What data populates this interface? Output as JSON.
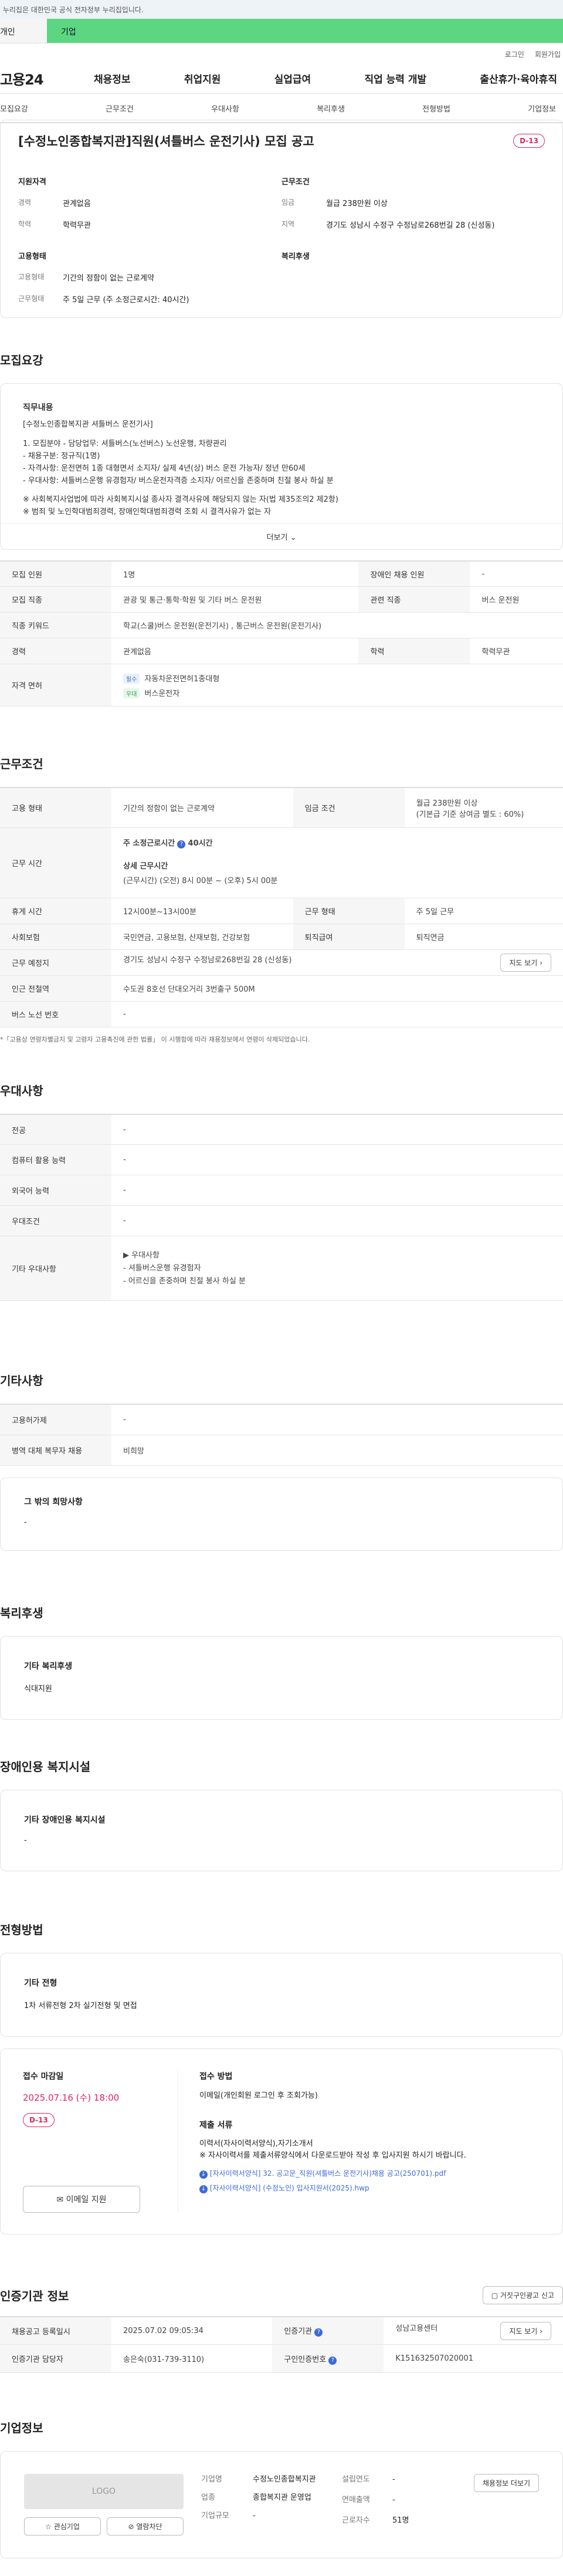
{
  "notice": "이 누리집은 대한민국 공식 전자정부 누리집입니다.",
  "top_tabs": [
    "개인",
    "기업"
  ],
  "util": [
    "로그인",
    "회원가입"
  ],
  "logo": "고용24",
  "gnb": [
    "채용정보",
    "취업지원",
    "실업급여",
    "직업 능력 개발",
    "출산휴가·육아휴직"
  ],
  "sub_tabs": [
    "모집요강",
    "근무조건",
    "우대사항",
    "복리후생",
    "전형방법",
    "기업정보"
  ],
  "title": "[수정노인종합복지관]직원(셔틀버스 운전기사) 모집 공고",
  "dday": "D-13",
  "summary": {
    "left_title": "지원자격",
    "career_k": "경력",
    "career_v": "관계없음",
    "edu_k": "학력",
    "edu_v": "학력무관",
    "emp_title": "고용형태",
    "emp_k": "고용형태",
    "emp_v": "기간의 정함이 없는 근로계약",
    "work_k": "근무형태",
    "work_v": "주 5일 근무 (주 소정근로시간: 40시간)",
    "right_title": "근무조건",
    "wage_k": "임금",
    "wage_v": "월급 238만원 이상",
    "region_k": "지역",
    "region_v": "경기도 성남시 수정구 수정남로268번길 28 (신성동)",
    "welfare_title": "복리후생"
  },
  "recruit_title": "모집요강",
  "job_content": {
    "label": "직무내용",
    "lines": [
      "[수정노인종합복지관 셔틀버스 운전기사]",
      "",
      "1. 모집분야 - 담당업무: 셔틀버스(노선버스) 노선운행, 차량관리",
      "- 채용구분: 정규직(1명)",
      "- 자격사항: 운전면허 1종 대형면서 소지자/ 실제 4년(상) 버스 운전 가능자/ 정년 만60세",
      "- 우대사항: 셔틀버스운행 유경험자/ 버스운전자격증 소지자/ 어르신을 존중하며 친절 봉사 하실 분",
      "",
      "※ 사회복지사업법에 따라 사회복지시설 종사자 결격사유에 해당되지 않는 자(법 제35조의2 제2항)",
      "※ 범죄 및 노인학대범죄경력, 장애인학대범죄경력 조회 시 결격사유가 없는 자"
    ],
    "more": "더보기"
  },
  "recruit_table": {
    "count_k": "모집 인원",
    "count_v": "1명",
    "disabled_k": "장애인 채용 인원",
    "disabled_v": "-",
    "job_k": "모집 직종",
    "job_v": "관광 및 통근·통학·학원 및 기타 버스 운전원",
    "rel_k": "관련 직종",
    "rel_v": "버스 운전원",
    "kw_k": "직종 키워드",
    "kw_v": "학교(스쿨)버스 운전원(운전기사) , 통근버스 운전원(운전기사)",
    "career_k": "경력",
    "career_v": "관계없음",
    "edu_k": "학력",
    "edu_v": "학력무관",
    "license_k": "자격 면허",
    "license_1_tag": "필수",
    "license_1": "자동차운전면허1종대형",
    "license_2_tag": "우대",
    "license_2": "버스운전자"
  },
  "work_title": "근무조건",
  "work_table": {
    "emp_k": "고용 형태",
    "emp_v": "기간의 정함이 없는 근로계약",
    "wage_k": "임금 조건",
    "wage_v": "월급 238만원 이상",
    "wage_sub": "(기본급 기준 상여금 별도 : 60%)",
    "time_k": "근무 시간",
    "time_v1": "주 소정근로시간",
    "time_v1b": "40시간",
    "time_v2": "상세 근무시간",
    "time_v3": "(근무시간) (오전) 8시 00분 ~ (오후) 5시 00분",
    "rest_k": "휴게 시간",
    "rest_v": "12시00분~13시00분",
    "form_k": "근무 형태",
    "form_v": "주 5일 근무",
    "ins_k": "사회보험",
    "ins_v": "국민연금, 고용보험, 산재보험, 건강보험",
    "ret_k": "퇴직급여",
    "ret_v": "퇴직연금",
    "place_k": "근무 예정지",
    "place_v": "경기도 성남시 수정구 수정남로268번길 28 (신성동)",
    "map_btn": "지도 보기",
    "sub_k": "인근 전철역",
    "sub_v": "수도권 8호선 단대오거리 3번출구 500M",
    "bus_k": "버스 노선 번호",
    "bus_v": "-"
  },
  "footnote": "*「고용상 연령차별금지 및 고령자 고용촉진에 관한 법률」 이 시행함에 따라 채용정보에서 연령이 삭제되었습니다.",
  "prefer_title": "우대사항",
  "prefer_table": {
    "major_k": "전공",
    "major_v": "-",
    "pc_k": "컴퓨터 활용 능력",
    "pc_v": "-",
    "lang_k": "외국어 능력",
    "lang_v": "-",
    "cond_k": "우대조건",
    "cond_v": "-",
    "etc_k": "기타 우대사항",
    "etc_lines": [
      "▶ 우대사항",
      "- 셔틀버스운행 유경험자",
      "- 어르신을 존중하며 친절 봉사 하실 분"
    ]
  },
  "other_title": "기타사항",
  "other_table": {
    "dorm_k": "고용허가제",
    "dorm_v": "-",
    "mil_k": "병역 대체 복무자 채용",
    "mil_v": "비희망"
  },
  "other_card": {
    "label": "그 밖의 희망사항",
    "value": "-"
  },
  "welfare_title": "복리후생",
  "welfare_card": {
    "label": "기타 복리후생",
    "value": "식대지원"
  },
  "disab_title": "장애인용 복지시설",
  "disab_card": {
    "label": "기타 장애인용 복지시설",
    "value": "-"
  },
  "selection_title": "전형방법",
  "selection_card": {
    "label": "기타 전형",
    "value": "1차 서류전형 2차 실기전형 및 면접"
  },
  "apply": {
    "deadline_k": "접수 마감일",
    "deadline_v": "2025.07.16 (수) 18:00",
    "dday": "D-13",
    "apply_btn": "이메일 지원",
    "method_k": "접수 방법",
    "method_v": "이메일(개인회원 로그인 후 조회가능)",
    "docs_k": "제출 서류",
    "docs_v1": "이력서(자사이력서양식),자기소개서",
    "docs_v2": "※ 자사이력서를 제출서류양식에서 다운로드받아 작성 후 입사지원 하시기 바랍니다.",
    "file1": "[자사이력서양식] 32. 공고문_직원(셔틀버스 운전기사)채용 공고(250701).pdf",
    "file2": "[자사이력서양식] (수정노인) 입사지원서(2025).hwp"
  },
  "cert_title": "인증기관 정보",
  "cert_btn": "거짓구인광고 신고",
  "cert_table": {
    "reg_k": "채용공고 등록일시",
    "reg_v": "2025.07.02 09:05:34",
    "org_k": "인증기관",
    "org_v": "성남고용센터",
    "map_btn": "지도 보기",
    "mgr_k": "인증기관 담당자",
    "mgr_v": "송은숙(031-739-3110)",
    "num_k": "구인인증번호",
    "num_v": "K151632507020001"
  },
  "company_title": "기업정보",
  "company": {
    "logo": "LOGO",
    "fav_btn": "관심기업",
    "block_btn": "열람차단",
    "name_k": "기업명",
    "name_v": "수정노인종합복지관",
    "ind_k": "업종",
    "ind_v": "종합복지관 운영업",
    "size_k": "기업규모",
    "size_v": "-",
    "year_k": "설립연도",
    "year_v": "-",
    "sales_k": "연매출액",
    "sales_v": "-",
    "emp_k": "근로자수",
    "emp_v": "51명",
    "more_btn": "채용정보 더보기"
  }
}
